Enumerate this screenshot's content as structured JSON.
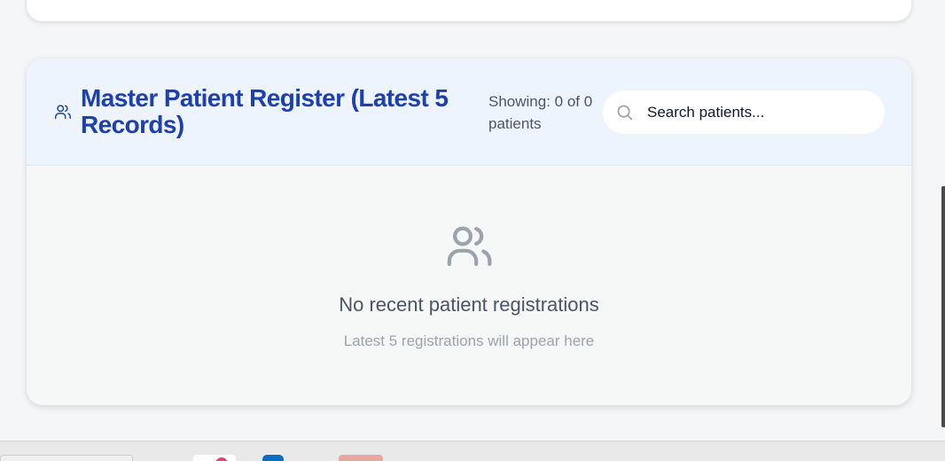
{
  "register": {
    "title": "Master Patient Register (Latest 5 Records)",
    "showing": "Showing: 0 of 0 patients",
    "search_placeholder": "Search patients..."
  },
  "empty_state": {
    "title": "No recent patient registrations",
    "subtitle": "Latest 5 registrations will appear here"
  },
  "icons": {
    "header": "users-icon",
    "search": "search-icon",
    "empty": "users-icon"
  },
  "colors": {
    "title": "#1e40af",
    "header_bg": "#edf4fe",
    "card_bg": "#f6f7f7",
    "muted_text": "#9ca3af"
  }
}
